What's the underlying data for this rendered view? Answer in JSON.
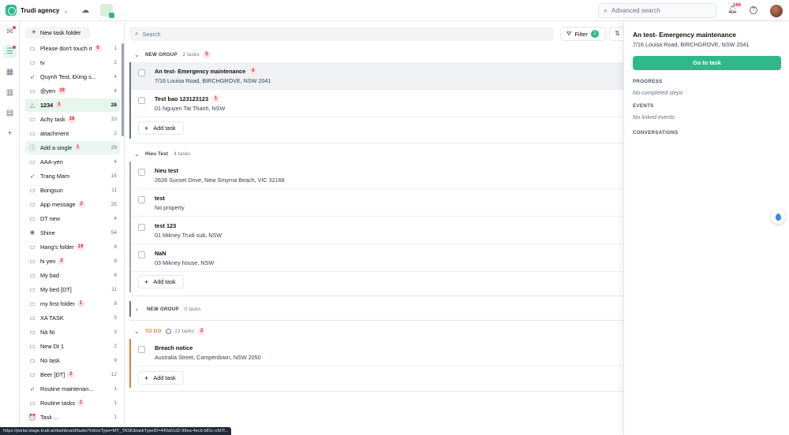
{
  "topbar": {
    "agency_name": "Trudi agency",
    "advanced_search_placeholder": "Advanced search",
    "notification_count": "166"
  },
  "sidebar": {
    "new_folder_label": "New task folder",
    "folders": [
      {
        "name": "Please don't touch it",
        "badge": "6",
        "count": "1",
        "icon": "folder-icon"
      },
      {
        "name": "tv",
        "badge": "",
        "count": "2",
        "icon": "folder-icon"
      },
      {
        "name": "Quynh Test, Đừng s...",
        "badge": "",
        "count": "4",
        "icon": "rocket-icon"
      },
      {
        "name": "@yen",
        "badge": "39",
        "count": "4",
        "icon": "folder-icon"
      },
      {
        "name": "1234",
        "badge": "3",
        "count": "28",
        "icon": "bell-icon"
      },
      {
        "name": "Achy task",
        "badge": "18",
        "count": "33",
        "icon": "folder-icon"
      },
      {
        "name": "attachment",
        "badge": "",
        "count": "2",
        "icon": "folder-icon"
      },
      {
        "name": "Add a single",
        "badge": "1",
        "count": "29",
        "icon": "info-icon"
      },
      {
        "name": "AAA-yen",
        "badge": "",
        "count": "4",
        "icon": "folder-icon"
      },
      {
        "name": "Trang Mam",
        "badge": "",
        "count": "15",
        "icon": "rocket-icon"
      },
      {
        "name": "Bongsun",
        "badge": "",
        "count": "11",
        "icon": "folder-icon"
      },
      {
        "name": "App message",
        "badge": "2",
        "count": "25",
        "icon": "folder-icon"
      },
      {
        "name": "DT new",
        "badge": "",
        "count": "4",
        "icon": "folder-icon"
      },
      {
        "name": "Shine",
        "badge": "",
        "count": "54",
        "icon": "sun-icon"
      },
      {
        "name": "Hang's folder",
        "badge": "19",
        "count": "8",
        "icon": "folder-icon"
      },
      {
        "name": "hi yen",
        "badge": "2",
        "count": "8",
        "icon": "folder-icon"
      },
      {
        "name": "My bad",
        "badge": "",
        "count": "6",
        "icon": "folder-icon"
      },
      {
        "name": "My bed [DT]",
        "badge": "",
        "count": "11",
        "icon": "folder-icon"
      },
      {
        "name": "my first folder",
        "badge": "1",
        "count": "8",
        "icon": "folder-icon"
      },
      {
        "name": "XA TASK",
        "badge": "",
        "count": "5",
        "icon": "folder-icon"
      },
      {
        "name": "Nà Ní",
        "badge": "",
        "count": "3",
        "icon": "folder-icon"
      },
      {
        "name": "New Dt 1",
        "badge": "",
        "count": "2",
        "icon": "folder-icon"
      },
      {
        "name": "No task",
        "badge": "",
        "count": "9",
        "icon": "folder-icon"
      },
      {
        "name": "Beer [DT]",
        "badge": "2",
        "count": "12",
        "icon": "folder-icon"
      },
      {
        "name": "Routine maintenan...",
        "badge": "",
        "count": "1",
        "icon": "rocket-icon"
      },
      {
        "name": "Routine tasks",
        "badge": "1",
        "count": "1",
        "icon": "folder-icon"
      },
      {
        "name": "Task ...",
        "badge": "",
        "count": "1",
        "icon": "alarm-icon"
      }
    ]
  },
  "main": {
    "search_placeholder": "Search",
    "filter_label": "Filter",
    "filter_count": "1",
    "groups": [
      {
        "name": "NEW GROUP",
        "count_label": "2 tasks",
        "badge": "5",
        "expanded": true,
        "add_label": "Add task",
        "tasks": [
          {
            "title": "An test- Emergency maintenance",
            "badge": "4",
            "address": "7/16 Louisa Road, BIRCHGROVE, NSW 2041"
          },
          {
            "title": "Test bao 123123123",
            "badge": "1",
            "address": "01 Nguyen Tat Thanh, NSW"
          }
        ]
      },
      {
        "name": "Hieu Test",
        "count_label": "4 tasks",
        "badge": "",
        "expanded": true,
        "add_label": "Add task",
        "tasks": [
          {
            "title": "hieu test",
            "badge": "",
            "address": "2628 Sunset Drive, New Smyrna Beach, VIC 32168"
          },
          {
            "title": "test",
            "badge": "",
            "address": "No property"
          },
          {
            "title": "test 123",
            "badge": "",
            "address": "01 Mikney Trudi sub, NSW"
          },
          {
            "title": "NaN",
            "badge": "",
            "address": "03 Mikney house, NSW"
          }
        ]
      },
      {
        "name": "NEW GROUP",
        "count_label": "0 tasks",
        "badge": "",
        "expanded": false
      },
      {
        "name": "TO DO",
        "count_label": "22 tasks",
        "badge": "2",
        "expanded": true,
        "add_label": "Add task",
        "tasks": [
          {
            "title": "Breach notice",
            "badge": "",
            "address": "Australia Street, Camperdown, NSW 2050"
          }
        ]
      }
    ]
  },
  "panel": {
    "title": "An test- Emergency maintenance",
    "address": "7/16 Louisa Road, BIRCHGROVE, NSW 2041",
    "go_to_task_label": "Go to task",
    "progress_label": "PROGRESS",
    "progress_value": "No completed steps",
    "events_label": "EVENTS",
    "events_value": "No linked events",
    "conversations_label": "CONVERSATIONS"
  },
  "status_url": "https://portal.stage.trudi.ai/dashboard/tasks?inboxType=MY_TASK&taskTypeID=440a51d2-99ea-4ecb-b81c-cfd7f...",
  "colors": {
    "accent": "#2fb889",
    "badge_bg": "#fde2e4",
    "badge_text": "#dc2626",
    "todo": "#e07a3e"
  }
}
